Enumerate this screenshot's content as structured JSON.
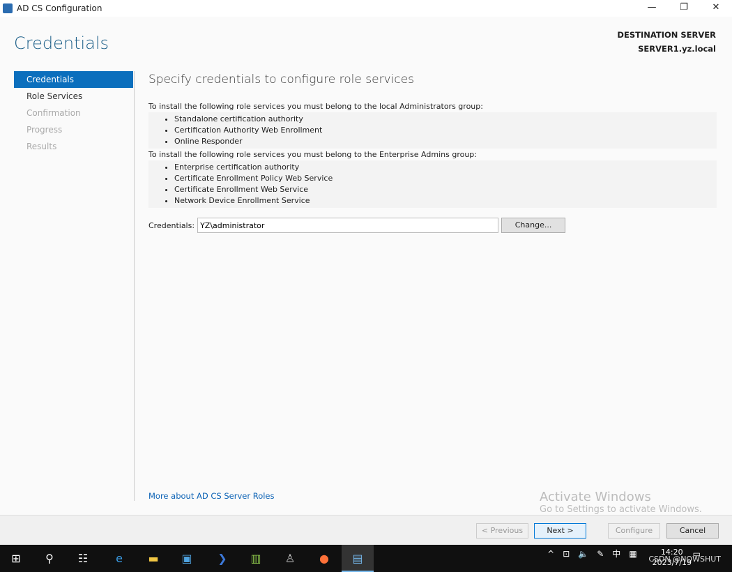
{
  "window": {
    "title": "AD CS Configuration",
    "minimize": "—",
    "maximize": "❐",
    "close": "✕"
  },
  "page_title": "Credentials",
  "destination": {
    "label": "DESTINATION SERVER",
    "server": "SERVER1.yz.local"
  },
  "nav": [
    {
      "label": "Credentials",
      "state": "active"
    },
    {
      "label": "Role Services",
      "state": "enabled"
    },
    {
      "label": "Confirmation",
      "state": "disabled"
    },
    {
      "label": "Progress",
      "state": "disabled"
    },
    {
      "label": "Results",
      "state": "disabled"
    }
  ],
  "main": {
    "heading": "Specify credentials to configure role services",
    "local_intro": "To install the following role services you must belong to the local Administrators group:",
    "local_items": [
      "Standalone certification authority",
      "Certification Authority Web Enrollment",
      "Online Responder"
    ],
    "enterprise_intro": "To install the following role services you must belong to the Enterprise Admins group:",
    "enterprise_items": [
      "Enterprise certification authority",
      "Certificate Enrollment Policy Web Service",
      "Certificate Enrollment Web Service",
      "Network Device Enrollment Service"
    ],
    "credentials_label": "Credentials:",
    "credentials_value": "YZ\\administrator",
    "change_button": "Change...",
    "more_link": "More about AD CS Server Roles"
  },
  "watermark": {
    "line1": "Activate Windows",
    "line2": "Go to Settings to activate Windows."
  },
  "footer": {
    "previous": "< Previous",
    "next": "Next >",
    "configure": "Configure",
    "cancel": "Cancel"
  },
  "taskbar": {
    "time": "14:20",
    "date": "2023/7/19",
    "ime": "中",
    "overlay": "CSDN @NOWSHUT"
  }
}
